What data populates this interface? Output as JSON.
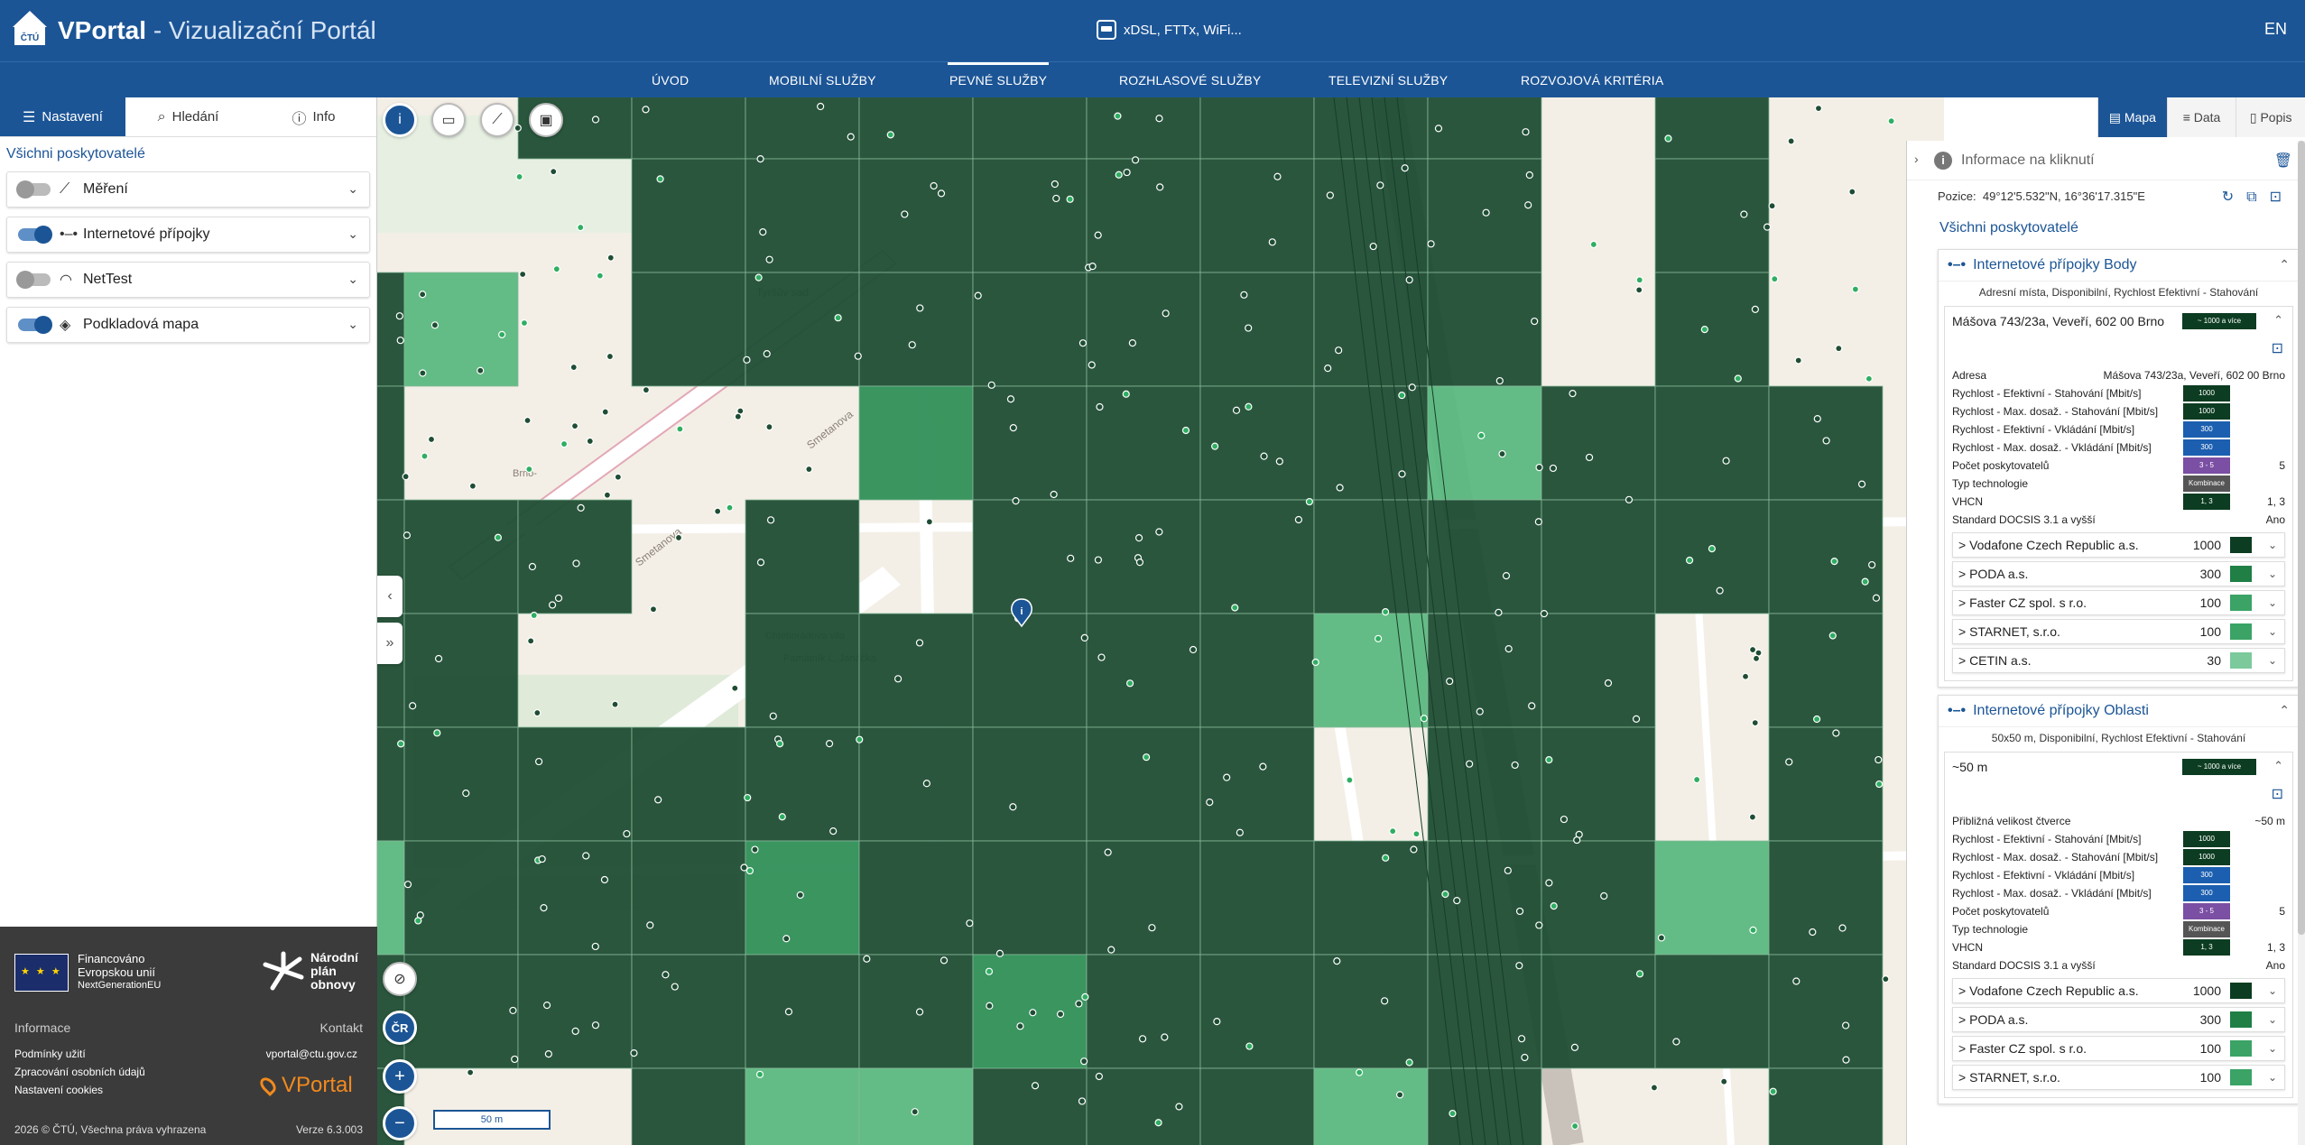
{
  "header": {
    "brand": "VPortal",
    "subtitle": "- Vizualizační Portál",
    "dataset": "xDSL, FTTx, WiFi...",
    "lang": "EN",
    "logo_text": "ČTÚ"
  },
  "nav": [
    {
      "label": "ÚVOD",
      "active": false
    },
    {
      "label": "MOBILNÍ SLUŽBY",
      "active": false
    },
    {
      "label": "PEVNÉ SLUŽBY",
      "active": true
    },
    {
      "label": "ROZHLASOVÉ SLUŽBY",
      "active": false
    },
    {
      "label": "TELEVIZNÍ SLUŽBY",
      "active": false
    },
    {
      "label": "ROZVOJOVÁ KRITÉRIA",
      "active": false
    }
  ],
  "left": {
    "tabs": [
      {
        "label": "Nastavení",
        "icon": "sliders-icon",
        "active": true
      },
      {
        "label": "Hledání",
        "icon": "search-icon",
        "active": false
      },
      {
        "label": "Info",
        "icon": "info-icon",
        "active": false
      }
    ],
    "providers_title": "Všichni poskytovatelé",
    "layers": [
      {
        "label": "Měření",
        "on": false,
        "icon": "chart-line-icon"
      },
      {
        "label": "Internetové přípojky",
        "on": true,
        "icon": "dots-line-icon"
      },
      {
        "label": "NetTest",
        "on": false,
        "icon": "gauge-icon"
      },
      {
        "label": "Podkladová mapa",
        "on": true,
        "icon": "layers-icon"
      }
    ],
    "footer": {
      "eu_line1": "Financováno",
      "eu_line2": "Evropskou unií",
      "eu_line3": "NextGenerationEU",
      "npo_line1": "Národní",
      "npo_line2": "plán",
      "npo_line3": "obnovy",
      "info": "Informace",
      "contact": "Kontakt",
      "terms": "Podmínky užití",
      "privacy": "Zpracování osobních údajů",
      "cookies": "Nastavení cookies",
      "email": "vportal@ctu.gov.cz",
      "brand": "VPortal",
      "copyright": "2026 © ČTÚ, Všechna práva vyhrazena",
      "version": "Verze 6.3.003"
    }
  },
  "map": {
    "scale_label": "50 m",
    "labels": {
      "park": "Tyršův sad",
      "street1": "Smetanova",
      "street2": "Smetanova",
      "district": "Brno-",
      "garden": "Chleborádova vila",
      "garden2": "Památník L. Janáčka"
    },
    "tools": {
      "country": "ČR",
      "zoom_in": "+",
      "zoom_out": "−"
    },
    "colors": {
      "dark": "#1f4d34",
      "mid": "#2f8f57",
      "light": "#5bb880",
      "grid": "#86b899"
    }
  },
  "right": {
    "view_tabs": [
      {
        "label": "Mapa",
        "active": true
      },
      {
        "label": "Data",
        "active": false
      },
      {
        "label": "Popis",
        "active": false
      }
    ],
    "title": "Informace na kliknutí",
    "position_label": "Pozice:",
    "position_value": "49°12'5.532\"N, 16°36'17.315\"E",
    "providers_title": "Všichni poskytovatelé",
    "sections": [
      {
        "title": "Internetové přípojky Body",
        "subtitle": "Adresní místa, Disponibilní, Rychlost Efektivní - Stahování",
        "item_title": "Mášova 743/23a, Veveří, 602 00 Brno",
        "badge": "~ 1000 a více",
        "rows": [
          {
            "label": "Adresa",
            "value": "Mášova 743/23a, Veveří, 602 00 Brno"
          },
          {
            "label": "Rychlost - Efektivní - Stahování [Mbit/s]",
            "chip": "1000",
            "chip_color": "#0c3c21"
          },
          {
            "label": "Rychlost - Max. dosaž. - Stahování [Mbit/s]",
            "chip": "1000",
            "chip_color": "#0c3c21"
          },
          {
            "label": "Rychlost - Efektivní - Vkládání [Mbit/s]",
            "chip": "300",
            "chip_color": "#1c5fb0"
          },
          {
            "label": "Rychlost - Max. dosaž. - Vkládání [Mbit/s]",
            "chip": "300",
            "chip_color": "#1c5fb0"
          },
          {
            "label": "Počet poskytovatelů",
            "chip": "3 - 5",
            "chip_color": "#7b4fa3",
            "value": "5"
          },
          {
            "label": "Typ technologie",
            "chip": "Kombinace",
            "chip_color": "#555555"
          },
          {
            "label": "VHCN",
            "chip": "1, 3",
            "chip_color": "#0c3c21",
            "value": "1, 3"
          },
          {
            "label": "Standard DOCSIS 3.1 a vyšší",
            "value": "Ano"
          }
        ],
        "providers": [
          {
            "name": "> Vodafone Czech Republic a.s.",
            "value": "1000",
            "color": "#0c3c21"
          },
          {
            "name": "> PODA a.s.",
            "value": "300",
            "color": "#1f7f45"
          },
          {
            "name": "> Faster CZ spol. s r.o.",
            "value": "100",
            "color": "#3aa365"
          },
          {
            "name": "> STARNET, s.r.o.",
            "value": "100",
            "color": "#3aa365"
          },
          {
            "name": "> CETIN a.s.",
            "value": "30",
            "color": "#7cc99b"
          }
        ]
      },
      {
        "title": "Internetové přípojky Oblasti",
        "subtitle": "50x50 m, Disponibilní, Rychlost Efektivní - Stahování",
        "item_title": "~50 m",
        "badge": "~ 1000 a více",
        "rows": [
          {
            "label": "Přibližná velikost čtverce",
            "value": "~50 m"
          },
          {
            "label": "Rychlost - Efektivní - Stahování [Mbit/s]",
            "chip": "1000",
            "chip_color": "#0c3c21"
          },
          {
            "label": "Rychlost - Max. dosaž. - Stahování [Mbit/s]",
            "chip": "1000",
            "chip_color": "#0c3c21"
          },
          {
            "label": "Rychlost - Efektivní - Vkládání [Mbit/s]",
            "chip": "300",
            "chip_color": "#1c5fb0"
          },
          {
            "label": "Rychlost - Max. dosaž. - Vkládání [Mbit/s]",
            "chip": "300",
            "chip_color": "#1c5fb0"
          },
          {
            "label": "Počet poskytovatelů",
            "chip": "3 - 5",
            "chip_color": "#7b4fa3",
            "value": "5"
          },
          {
            "label": "Typ technologie",
            "chip": "Kombinace",
            "chip_color": "#555555"
          },
          {
            "label": "VHCN",
            "chip": "1, 3",
            "chip_color": "#0c3c21",
            "value": "1, 3"
          },
          {
            "label": "Standard DOCSIS 3.1 a vyšší",
            "value": "Ano"
          }
        ],
        "providers": [
          {
            "name": "> Vodafone Czech Republic a.s.",
            "value": "1000",
            "color": "#0c3c21"
          },
          {
            "name": "> PODA a.s.",
            "value": "300",
            "color": "#1f7f45"
          },
          {
            "name": "> Faster CZ spol. s r.o.",
            "value": "100",
            "color": "#3aa365"
          },
          {
            "name": "> STARNET, s.r.o.",
            "value": "100",
            "color": "#3aa365"
          }
        ]
      }
    ]
  }
}
